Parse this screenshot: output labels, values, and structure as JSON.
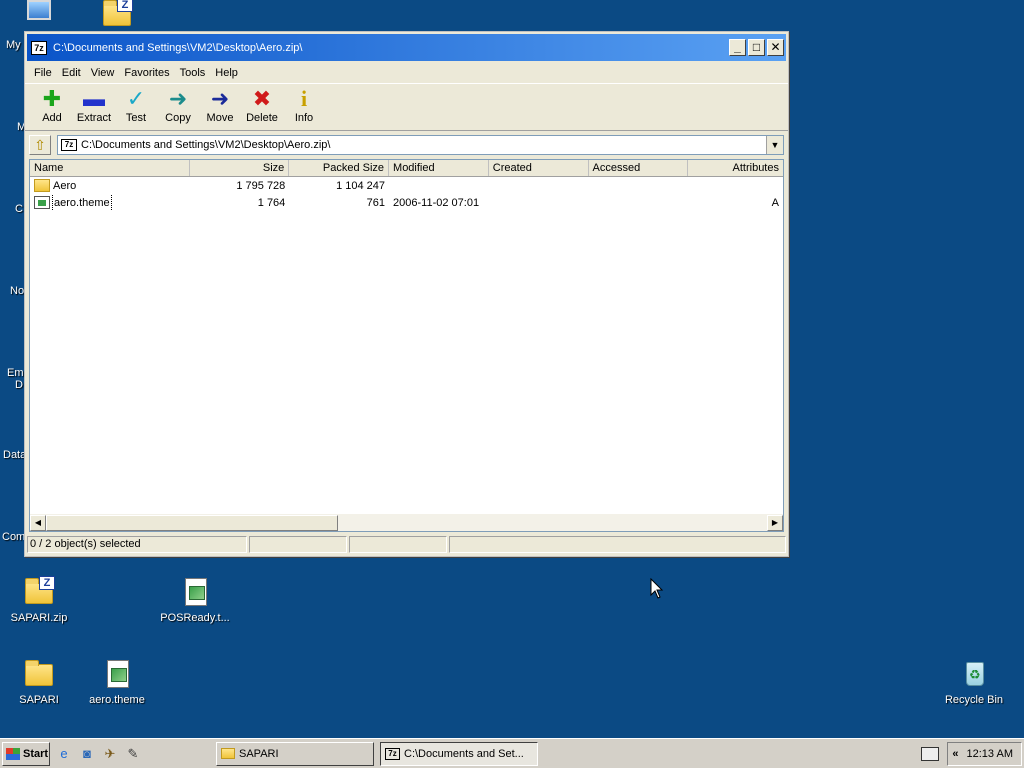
{
  "desktop": {
    "icons": [
      {
        "label": "SAPARI.zip",
        "type": "zip"
      },
      {
        "label": "POSReady.t...",
        "type": "theme"
      },
      {
        "label": "SAPARI",
        "type": "folder"
      },
      {
        "label": "aero.theme",
        "type": "theme"
      },
      {
        "label": "Recycle Bin",
        "type": "recycle-bin"
      }
    ],
    "clipped_labels": [
      "My",
      "M",
      "C",
      "No",
      "Em",
      "D",
      "Data",
      "Com"
    ]
  },
  "window": {
    "title": "C:\\Documents and Settings\\VM2\\Desktop\\Aero.zip\\",
    "app_badge": "7z",
    "controls": {
      "minimize": "_",
      "maximize": "□",
      "close": "✕"
    },
    "menu": [
      "File",
      "Edit",
      "View",
      "Favorites",
      "Tools",
      "Help"
    ],
    "toolbar": [
      {
        "label": "Add",
        "icon": "plus-icon",
        "glyph": "✚",
        "color": "#1aa51a"
      },
      {
        "label": "Extract",
        "icon": "minus-icon",
        "glyph": "▬",
        "color": "#2233cc"
      },
      {
        "label": "Test",
        "icon": "check-icon",
        "glyph": "✓",
        "color": "#1aa8c8"
      },
      {
        "label": "Copy",
        "icon": "arrow-right-icon",
        "glyph": "➜",
        "color": "#1c8c8c"
      },
      {
        "label": "Move",
        "icon": "arrow-right-icon",
        "glyph": "➜",
        "color": "#1b2b9a"
      },
      {
        "label": "Delete",
        "icon": "x-icon",
        "glyph": "✖",
        "color": "#d01a1a"
      },
      {
        "label": "Info",
        "icon": "info-icon",
        "glyph": "i",
        "color": "#c8a000"
      }
    ],
    "address": "C:\\Documents and Settings\\VM2\\Desktop\\Aero.zip\\",
    "columns": [
      "Name",
      "Size",
      "Packed Size",
      "Modified",
      "Created",
      "Accessed",
      "Attributes"
    ],
    "rows": [
      {
        "name": "Aero",
        "size": "1 795 728",
        "packed": "1 104 247",
        "modified": "",
        "created": "",
        "accessed": "",
        "attributes": "",
        "type": "folder"
      },
      {
        "name": "aero.theme",
        "size": "1 764",
        "packed": "761",
        "modified": "2006-11-02 07:01",
        "created": "",
        "accessed": "",
        "attributes": "A",
        "type": "theme"
      }
    ],
    "status": "0 / 2 object(s) selected"
  },
  "taskbar": {
    "start_label": "Start",
    "tasks": [
      {
        "label": "SAPARI",
        "active": false
      },
      {
        "label": "C:\\Documents and Set...",
        "active": true
      }
    ],
    "tray_chevron": "«",
    "clock": "12:13 AM"
  }
}
